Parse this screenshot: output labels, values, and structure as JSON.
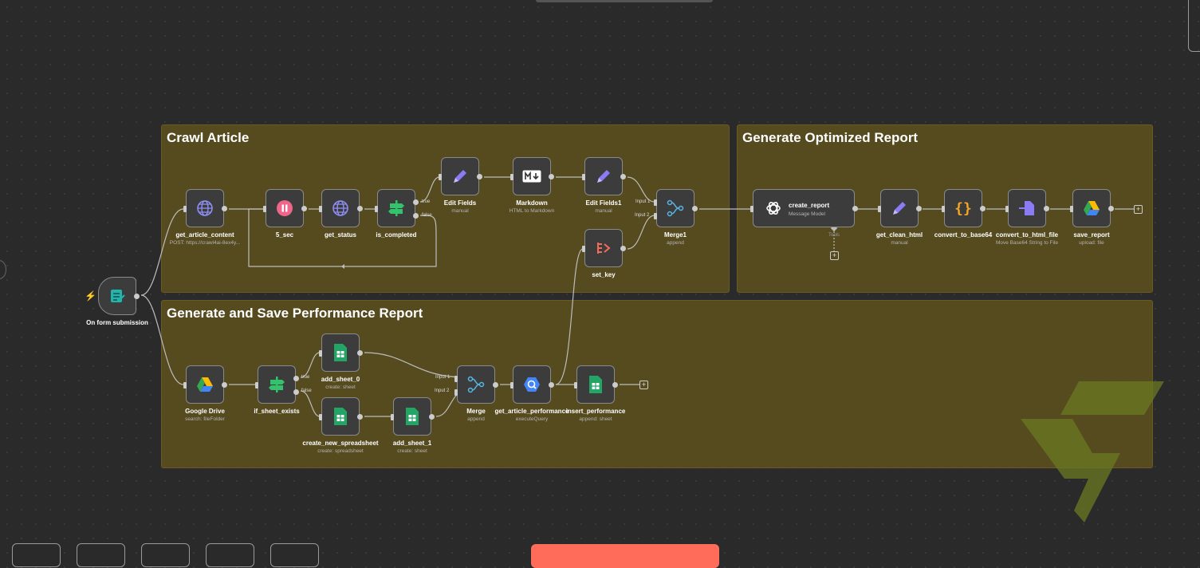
{
  "canvas": {
    "groups": [
      {
        "title": "Crawl Article"
      },
      {
        "title": "Generate Optimized Report"
      },
      {
        "title": "Generate and Save Performance Report"
      }
    ],
    "trigger": {
      "label": "On form submission",
      "icon": "form-icon"
    },
    "nodes": {
      "get_article_content": {
        "label": "get_article_content",
        "sub": "POST: https://crawl4ai-8ex4y...",
        "icon": "globe-icon"
      },
      "five_sec": {
        "label": "5_sec",
        "icon": "pause-icon"
      },
      "get_status": {
        "label": "get_status",
        "icon": "globe-icon"
      },
      "is_completed": {
        "label": "is_completed",
        "icon": "if-icon"
      },
      "edit_fields": {
        "label": "Edit Fields",
        "sub": "manual",
        "icon": "pencil-icon"
      },
      "markdown": {
        "label": "Markdown",
        "sub": "HTML to Markdown",
        "icon": "markdown-icon"
      },
      "edit_fields1": {
        "label": "Edit Fields1",
        "sub": "manual",
        "icon": "pencil-icon"
      },
      "set_key": {
        "label": "set_key",
        "icon": "code-bracket-icon"
      },
      "merge1": {
        "label": "Merge1",
        "sub": "append",
        "icon": "merge-icon"
      },
      "create_report": {
        "label": "create_report",
        "sub": "Message Model",
        "tools": "Tools",
        "icon": "openai-icon"
      },
      "get_clean_html": {
        "label": "get_clean_html",
        "sub": "manual",
        "icon": "pencil-icon"
      },
      "convert_to_base64": {
        "label": "convert_to_base64",
        "icon": "braces-icon"
      },
      "convert_to_html_file": {
        "label": "convert_to_html_file",
        "sub": "Move Base64 String to File",
        "icon": "file-convert-icon"
      },
      "save_report": {
        "label": "save_report",
        "sub": "upload: file",
        "icon": "google-drive-icon"
      },
      "google_drive": {
        "label": "Google Drive",
        "sub": "search: fileFolder",
        "icon": "google-drive-icon"
      },
      "if_sheet_exists": {
        "label": "if_sheet_exists",
        "icon": "if-icon"
      },
      "add_sheet_0": {
        "label": "add_sheet_0",
        "sub": "create: sheet",
        "icon": "sheets-icon"
      },
      "create_new_spreadsheet": {
        "label": "create_new_spreadsheet",
        "sub": "create: spreadsheet",
        "icon": "sheets-icon"
      },
      "add_sheet_1": {
        "label": "add_sheet_1",
        "sub": "create: sheet",
        "icon": "sheets-icon"
      },
      "merge": {
        "label": "Merge",
        "sub": "append",
        "icon": "merge-icon"
      },
      "get_article_performance": {
        "label": "get_article_performance",
        "sub": "executeQuery",
        "icon": "bigquery-icon"
      },
      "insert_performance": {
        "label": "insert_performance",
        "sub": "append: sheet",
        "icon": "sheets-icon"
      }
    },
    "branch_labels": {
      "true": "true",
      "false": "false",
      "input1": "Input 1",
      "input2": "Input 2"
    }
  },
  "colors": {
    "accent": "#ff6d5a",
    "sticky": "#5c4e1e",
    "node_bg": "#3c3c3c",
    "canvas": "#2a2a2a"
  }
}
